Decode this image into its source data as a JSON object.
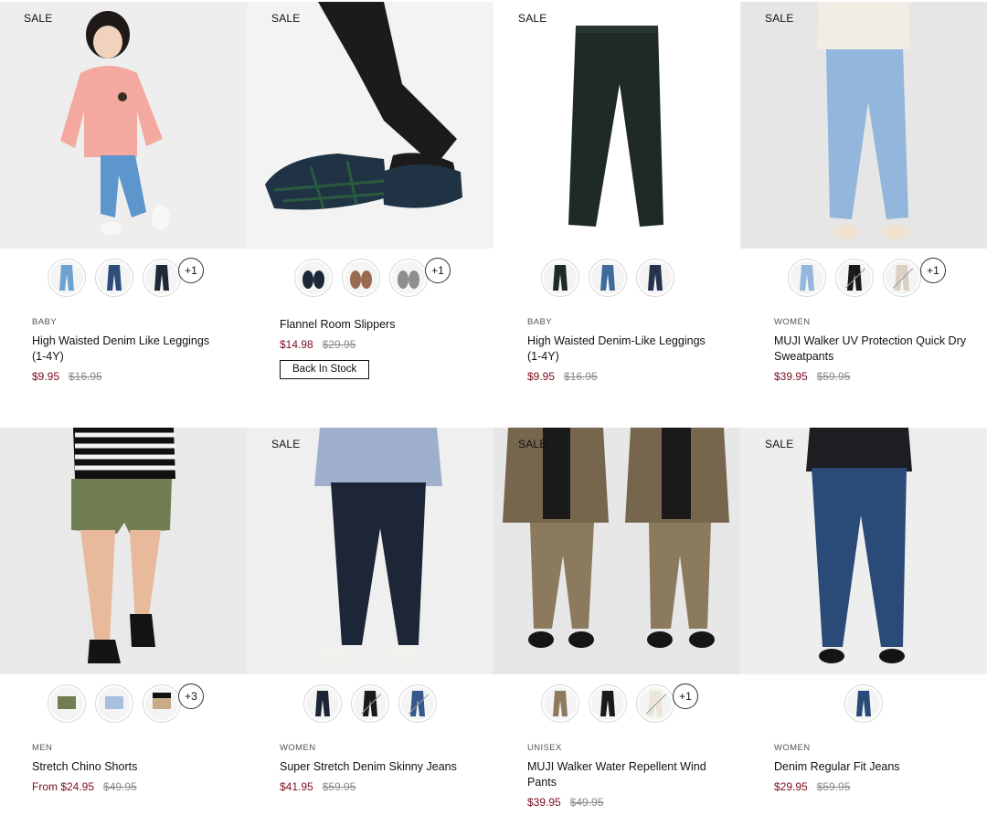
{
  "badges": {
    "sale": "SALE"
  },
  "products": [
    {
      "sale_label": "SALE",
      "category": "BABY",
      "name": "High Waisted Denim Like Leggings (1-4Y)",
      "price_sale": "$9.95",
      "price_original": "$16.95",
      "swatches": [
        "light-blue",
        "indigo",
        "dark-navy"
      ],
      "more_colors": "+1"
    },
    {
      "sale_label": "SALE",
      "category": "",
      "name": "Flannel Room Slippers",
      "price_sale": "$14.98",
      "price_original": "$29.95",
      "swatches": [
        "navy-check",
        "brown-check",
        "gray-check"
      ],
      "more_colors": "+1",
      "button": "Back In Stock"
    },
    {
      "sale_label": "SALE",
      "category": "BABY",
      "name": "High Waisted Denim-Like Leggings (1-4Y)",
      "price_sale": "$9.95",
      "price_original": "$16.95",
      "swatches": [
        "dark-green",
        "mid-blue",
        "navy"
      ]
    },
    {
      "sale_label": "SALE",
      "category": "WOMEN",
      "name": "MUJI Walker UV Protection Quick Dry Sweatpants",
      "price_sale": "$39.95",
      "price_original": "$59.95",
      "swatches": [
        "light-blue",
        "black",
        "beige"
      ],
      "more_colors": "+1"
    },
    {
      "sale_label": "",
      "category": "MEN",
      "name": "Stretch Chino Shorts",
      "price_sale": "From $24.95",
      "price_original": "$49.95",
      "swatches": [
        "khaki",
        "light-blue",
        "beige"
      ],
      "more_colors": "+3"
    },
    {
      "sale_label": "SALE",
      "category": "WOMEN",
      "name": "Super Stretch Denim Skinny Jeans",
      "price_sale": "$41.95",
      "price_original": "$59.95",
      "swatches": [
        "dark-navy",
        "black",
        "blue"
      ]
    },
    {
      "sale_label": "SALE",
      "category": "UNISEX",
      "name": "MUJI Walker Water Repellent Wind Pants",
      "price_sale": "$39.95",
      "price_original": "$49.95",
      "swatches": [
        "brown",
        "black",
        "ivory"
      ],
      "more_colors": "+1"
    },
    {
      "sale_label": "SALE",
      "category": "WOMEN",
      "name": "Denim Regular Fit Jeans",
      "price_sale": "$29.95",
      "price_original": "$59.95",
      "swatches": [
        "navy"
      ]
    }
  ],
  "colors": {
    "sale_price": "#7a0c1e",
    "original_price": "#8a8a8a",
    "text": "#111111",
    "photo_bg": "#efefef"
  }
}
